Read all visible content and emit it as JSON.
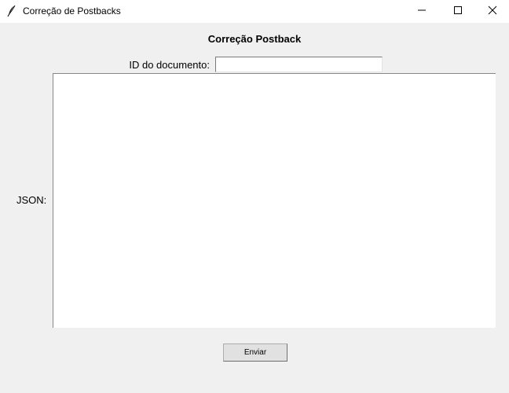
{
  "window": {
    "title": "Correção de Postbacks",
    "icon": "feather-icon",
    "controls": [
      "minimize-icon",
      "maximize-icon",
      "close-icon"
    ]
  },
  "form": {
    "heading": "Correção Postback",
    "id_label": "ID do documento:",
    "id_value": "",
    "json_label": "JSON:",
    "json_value": "",
    "submit_label": "Enviar"
  },
  "colors": {
    "window_bg": "#f0f0f0",
    "titlebar_bg": "#ffffff",
    "field_bg": "#ffffff",
    "button_bg": "#e1e1e1"
  }
}
